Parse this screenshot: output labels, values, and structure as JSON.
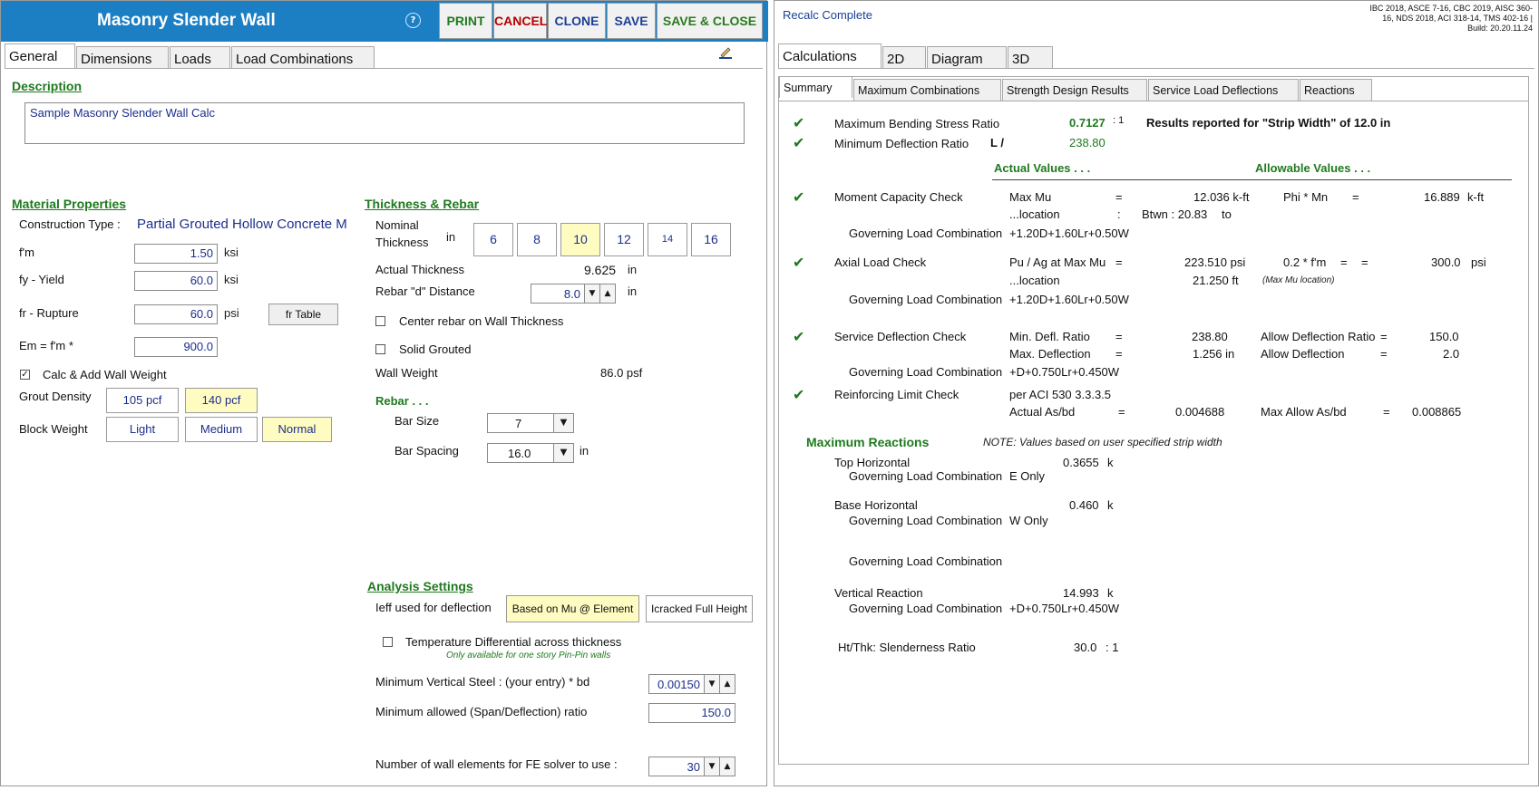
{
  "app": {
    "title": "Masonry Slender Wall",
    "help_glyph": "?",
    "toolbar": {
      "print": "PRINT",
      "cancel": "CANCEL",
      "clone": "CLONE",
      "save": "SAVE",
      "save_close": "SAVE & CLOSE"
    }
  },
  "left_tabs": [
    "General",
    "Dimensions",
    "Loads",
    "Load Combinations"
  ],
  "general": {
    "description_title": "Description",
    "description_value": "Sample Masonry Slender Wall Calc",
    "material": {
      "title": "Material Properties",
      "construction_label": "Construction Type :",
      "construction_value": "Partial Grouted Hollow Concrete M",
      "fm_label": "f'm",
      "fm_value": "1.50",
      "fm_unit": "ksi",
      "fy_label": "fy - Yield",
      "fy_value": "60.0",
      "fy_unit": "ksi",
      "fr_label": "fr - Rupture",
      "fr_value": "60.0",
      "fr_unit": "psi",
      "fr_table_button": "fr Table",
      "em_label": "Em = f'm *",
      "em_value": "900.0",
      "calc_wall_weight_label": "Calc & Add Wall Weight",
      "calc_wall_weight_checked": "✓",
      "grout_density_label": "Grout Density",
      "grout_options": [
        "105 pcf",
        "140 pcf"
      ],
      "block_weight_label": "Block Weight",
      "block_options": [
        "Light",
        "Medium",
        "Normal"
      ]
    },
    "thickness": {
      "title": "Thickness & Rebar",
      "nominal_label_1": "Nominal",
      "nominal_label_2": "Thickness",
      "nominal_unit": "in",
      "nominal_options": [
        "6",
        "8",
        "10",
        "12",
        "14",
        "16"
      ],
      "actual_label": "Actual Thickness",
      "actual_value": "9.625",
      "actual_unit": "in",
      "d_label": "Rebar \"d\" Distance",
      "d_value": "8.0",
      "d_unit": "in",
      "center_rebar_label": "Center rebar on Wall Thickness",
      "solid_grouted_label": "Solid Grouted",
      "wall_weight_label": "Wall Weight",
      "wall_weight_value": "86.0 psf",
      "rebar_title": "Rebar . . .",
      "bar_size_label": "Bar Size",
      "bar_size_value": "7",
      "bar_spacing_label": "Bar Spacing",
      "bar_spacing_value": "16.0",
      "bar_spacing_unit": "in"
    },
    "analysis": {
      "title": "Analysis Settings",
      "ieff_label": "Ieff used for deflection",
      "ieff_options": [
        "Based on Mu @ Element",
        "Icracked Full Height"
      ],
      "temp_label": "Temperature Differential across thickness",
      "temp_note": "Only available for one story Pin-Pin walls",
      "min_vert_steel_label": "Minimum Vertical Steel :  (your entry) * bd",
      "min_vert_steel_value": "0.00150",
      "min_span_defl_label": "Minimum allowed (Span/Deflection) ratio",
      "min_span_defl_value": "150.0",
      "num_elements_label": "Number of wall elements for FE solver to use :",
      "num_elements_value": "30"
    }
  },
  "right": {
    "status": "Recalc Complete",
    "codes_line1": "IBC 2018, ASCE 7-16, CBC 2019, AISC 360-",
    "codes_line2": "16, NDS 2018, ACI 318-14, TMS 402-16 |",
    "codes_line3": "Build: 20.20.11.24",
    "tabs": [
      "Calculations",
      "2D",
      "Diagram",
      "3D"
    ],
    "subtabs": [
      "Summary",
      "Maximum Combinations",
      "Strength Design Results",
      "Service Load Deflections",
      "Reactions"
    ],
    "summary": {
      "max_bending_label": "Maximum Bending Stress Ratio",
      "max_bending_value": "0.7127",
      "max_bending_suffix": ": 1",
      "strip_note": "Results reported for \"Strip Width\" of 12.0 in",
      "min_defl_label": "Minimum Deflection Ratio",
      "min_defl_prefix": "L /",
      "min_defl_value": "238.80",
      "actual_values": "Actual Values . . .",
      "allowable_values": "Allowable Values . . .",
      "moment_label": "Moment Capacity Check",
      "max_mu_label": "Max Mu",
      "eq": "=",
      "colon": ":",
      "max_mu_value": "12.036 k-ft",
      "phi_mn_label": "Phi * Mn",
      "phi_mn_value": "16.889",
      "phi_mn_unit": "k-ft",
      "location_label": "...location",
      "btwn_value": "Btwn : 20.83",
      "to_label": "to",
      "gov_label": "Governing Load Combination",
      "moment_gov": "+1.20D+1.60Lr+0.50W",
      "axial_label": "Axial Load Check",
      "pu_ag_label": "Pu / Ag at Max Mu",
      "pu_ag_value": "223.510 psi",
      "fm02_label": "0.2 * f'm",
      "fm02_value": "300.0",
      "fm02_unit": "psi",
      "axial_location_value": "21.250 ft",
      "max_mu_location": "(Max Mu location)",
      "axial_gov": "+1.20D+1.60Lr+0.50W",
      "service_label": "Service Deflection Check",
      "min_defl_ratio_label": "Min. Defl. Ratio",
      "min_defl_ratio_value": "238.80",
      "allow_defl_ratio_label": "Allow Deflection Ratio",
      "allow_defl_ratio_value": "150.0",
      "max_defl_label": "Max. Deflection",
      "max_defl_value": "1.256 in",
      "allow_defl_label": "Allow Deflection",
      "allow_defl_value": "2.0",
      "service_gov": "+D+0.750Lr+0.450W",
      "reinf_label": "Reinforcing Limit Check",
      "per_aci": "per ACI 530 3.3.3.5",
      "actual_asbd_label": "Actual As/bd",
      "actual_asbd_value": "0.004688",
      "max_asbd_label": "Max Allow As/bd",
      "max_asbd_value": "0.008865",
      "reactions_title": "Maximum Reactions",
      "reactions_note": "NOTE: Values based on user specified strip width",
      "top_horiz_label": "Top Horizontal",
      "top_horiz_value": "0.3655",
      "top_horiz_unit": "k",
      "top_gov": "E Only",
      "base_horiz_label": "Base Horizontal",
      "base_horiz_value": "0.460",
      "base_horiz_unit": "k",
      "base_gov": "W Only",
      "vert_label": "Vertical Reaction",
      "vert_value": "14.993",
      "vert_unit": "k",
      "vert_gov": "+D+0.750Lr+0.450W",
      "slender_label": "Ht/Thk: Slenderness Ratio",
      "slender_value": "30.0",
      "slender_suffix": ": 1"
    }
  },
  "colors": {
    "title_bar": "#1c7fc4",
    "green": "#1e7a1e",
    "blue_text": "#1c2e8c",
    "selected": "#fffcc2"
  }
}
